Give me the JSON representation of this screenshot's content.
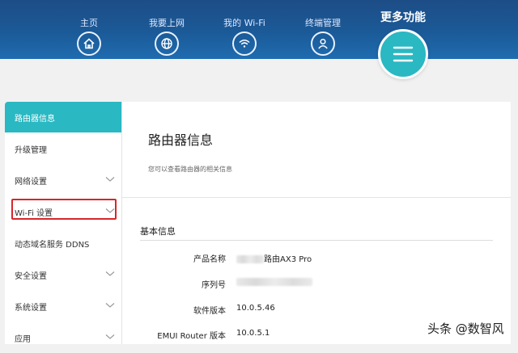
{
  "nav": {
    "items": [
      {
        "label": "主页",
        "icon": "home-icon"
      },
      {
        "label": "我要上网",
        "icon": "globe-icon"
      },
      {
        "label": "我的 Wi-Fi",
        "icon": "wifi-icon"
      },
      {
        "label": "终端管理",
        "icon": "user-icon"
      }
    ],
    "more_label": "更多功能",
    "more_icon": "menu-icon"
  },
  "sidebar": {
    "items": [
      {
        "label": "路由器信息",
        "active": true,
        "expandable": false
      },
      {
        "label": "升级管理",
        "active": false,
        "expandable": false
      },
      {
        "label": "网络设置",
        "active": false,
        "expandable": true
      },
      {
        "label": "Wi-Fi 设置",
        "active": false,
        "expandable": true
      },
      {
        "label": "动态域名服务 DDNS",
        "active": false,
        "expandable": false
      },
      {
        "label": "安全设置",
        "active": false,
        "expandable": true
      },
      {
        "label": "系统设置",
        "active": false,
        "expandable": true
      },
      {
        "label": "应用",
        "active": false,
        "expandable": true
      }
    ]
  },
  "main": {
    "title": "路由器信息",
    "subtitle": "您可以查看路由器的相关信息",
    "section_title": "基本信息",
    "info": [
      {
        "label": "产品名称",
        "value": "路由AX3 Pro"
      },
      {
        "label": "序列号",
        "value": ""
      },
      {
        "label": "软件版本",
        "value": "10.0.5.46"
      },
      {
        "label": "EMUI Router 版本",
        "value": "10.0.5.1"
      }
    ]
  },
  "watermark": "头条 @数智风",
  "colors": {
    "accent": "#2ab8c2",
    "header": "#1d5593",
    "highlight": "#d8262a"
  }
}
